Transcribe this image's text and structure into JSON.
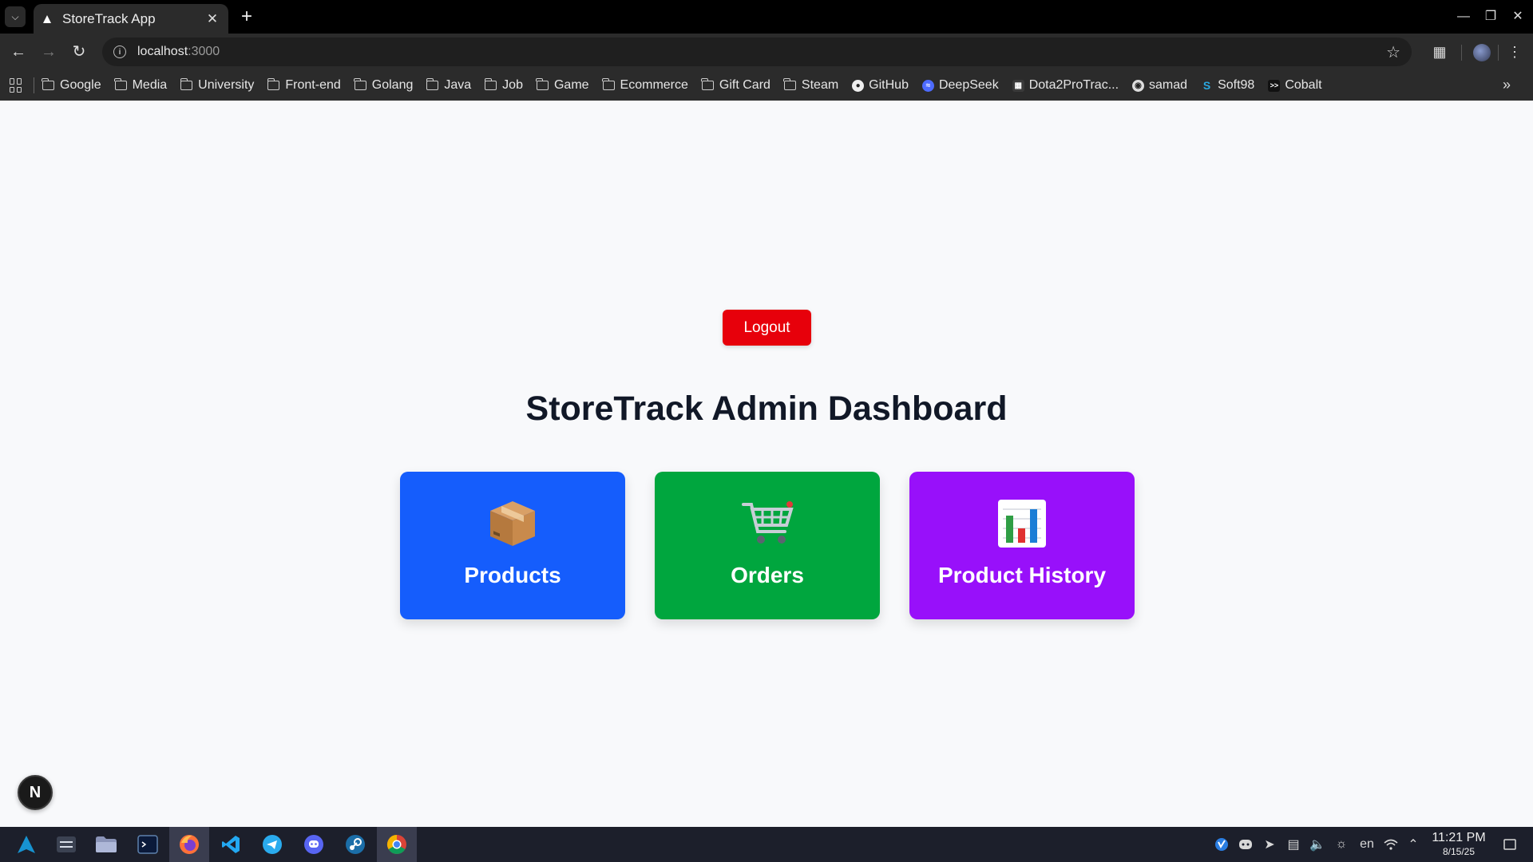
{
  "browser": {
    "tab_title": "StoreTrack App",
    "url_host": "localhost",
    "url_port": ":3000",
    "bookmarks": [
      {
        "label": "Google",
        "type": "folder"
      },
      {
        "label": "Media",
        "type": "folder"
      },
      {
        "label": "University",
        "type": "folder"
      },
      {
        "label": "Front-end",
        "type": "folder"
      },
      {
        "label": "Golang",
        "type": "folder"
      },
      {
        "label": "Java",
        "type": "folder"
      },
      {
        "label": "Job",
        "type": "folder"
      },
      {
        "label": "Game",
        "type": "folder"
      },
      {
        "label": "Ecommerce",
        "type": "folder"
      },
      {
        "label": "Gift Card",
        "type": "folder"
      },
      {
        "label": "Steam",
        "type": "folder"
      },
      {
        "label": "GitHub",
        "type": "site",
        "icon": "github-icon"
      },
      {
        "label": "DeepSeek",
        "type": "site",
        "icon": "deepseek-icon"
      },
      {
        "label": "Dota2ProTrac...",
        "type": "site",
        "icon": "dota2protracker-icon"
      },
      {
        "label": "samad",
        "type": "site",
        "icon": "samad-icon"
      },
      {
        "label": "Soft98",
        "type": "site",
        "icon": "soft98-icon"
      },
      {
        "label": "Cobalt",
        "type": "site",
        "icon": "cobalt-icon"
      }
    ]
  },
  "page": {
    "logout_label": "Logout",
    "title": "StoreTrack Admin Dashboard",
    "cards": [
      {
        "label": "Products",
        "icon": "package-icon",
        "color": "#155dfc"
      },
      {
        "label": "Orders",
        "icon": "shopping-cart-icon",
        "color": "#00a63e"
      },
      {
        "label": "Product History",
        "icon": "bar-chart-icon",
        "color": "#9810fa"
      }
    ],
    "dev_badge": "N"
  },
  "taskbar": {
    "language": "en",
    "time": "11:21 PM",
    "date": "8/15/25"
  },
  "colors": {
    "logout": "#e7000b",
    "page_bg": "#f8f9fb",
    "title_text": "#111827"
  }
}
